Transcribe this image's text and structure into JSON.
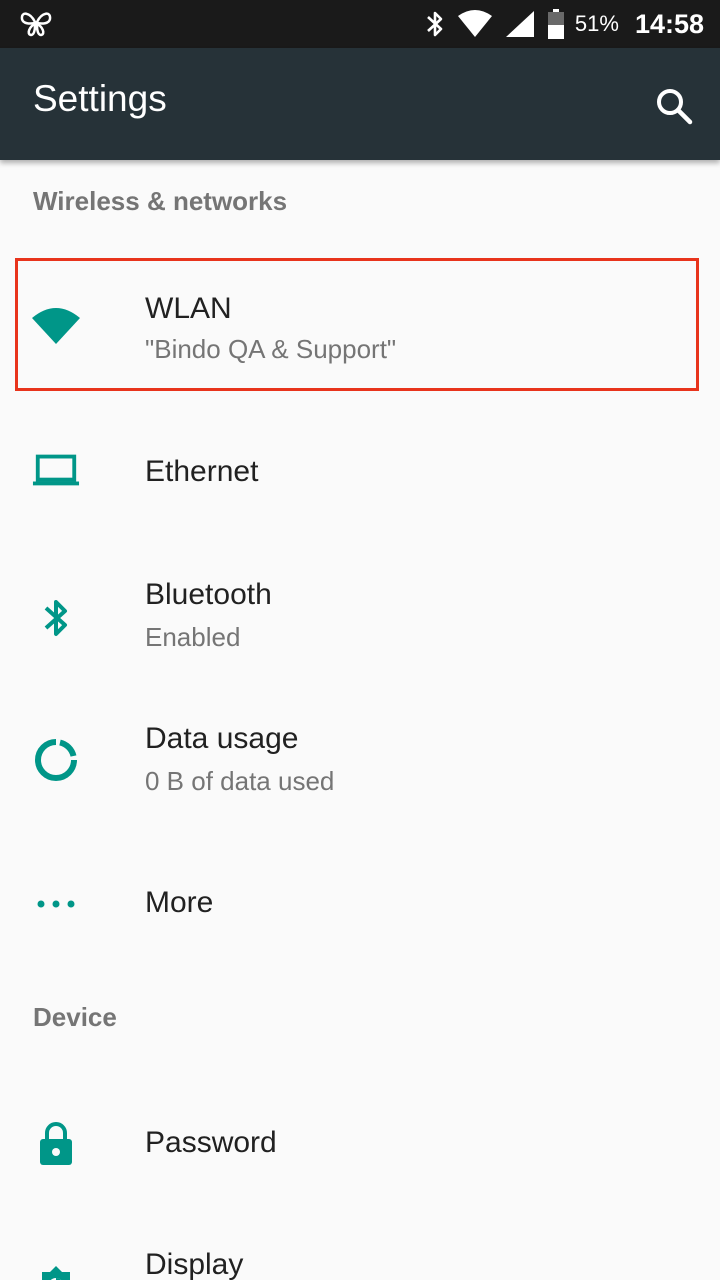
{
  "status_bar": {
    "battery_percent": "51%",
    "time": "14:58",
    "icons": [
      "butterfly-notification-icon",
      "bluetooth-icon",
      "wifi-icon",
      "cell-signal-icon",
      "battery-icon"
    ]
  },
  "app_bar": {
    "title": "Settings",
    "search_icon": "search-icon"
  },
  "sections": {
    "wireless": {
      "header": "Wireless & networks"
    },
    "device": {
      "header": "Device"
    }
  },
  "items": {
    "wlan": {
      "title": "WLAN",
      "subtitle": "\"Bindo QA & Support\"",
      "icon": "wifi-icon"
    },
    "ethernet": {
      "title": "Ethernet",
      "icon": "laptop-icon"
    },
    "bluetooth": {
      "title": "Bluetooth",
      "subtitle": "Enabled",
      "icon": "bluetooth-icon"
    },
    "data_usage": {
      "title": "Data usage",
      "subtitle": "0 B of data used",
      "icon": "data-usage-icon"
    },
    "more": {
      "title": "More",
      "icon": "more-dots-icon"
    },
    "password": {
      "title": "Password",
      "icon": "lock-icon"
    },
    "display": {
      "title": "Display",
      "icon": "brightness-icon"
    }
  },
  "colors": {
    "accent": "#009688",
    "app_bar": "#263238",
    "status_bar": "#1a1a1a",
    "highlight": "#e8341c"
  }
}
